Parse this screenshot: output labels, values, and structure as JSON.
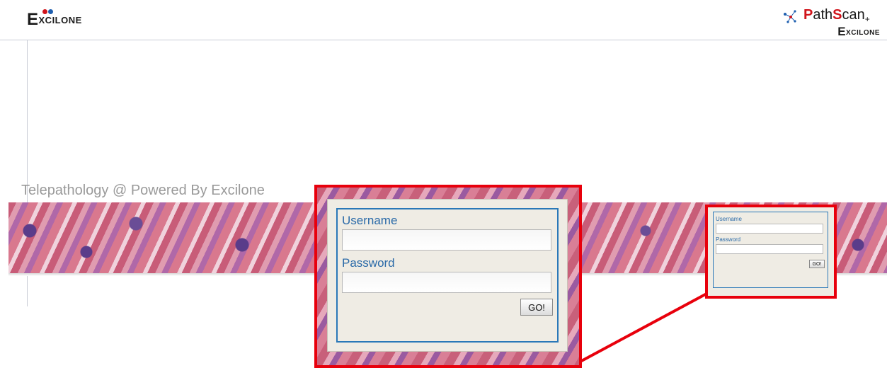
{
  "header": {
    "logo_left": {
      "initial": "E",
      "rest": "XCILONE"
    },
    "logo_right": {
      "title_p": "P",
      "title_ath": "ath",
      "title_s": "S",
      "title_can": "can",
      "title_plus": "+",
      "sub_initial": "E",
      "sub_rest": "XCILONE"
    }
  },
  "tagline": "Telepathology @ Powered By Excilone",
  "login": {
    "username_label": "Username",
    "username_value": "",
    "password_label": "Password",
    "password_value": "",
    "go_label": "GO!"
  },
  "colors": {
    "accent_red": "#e8000c",
    "label_blue": "#2a6aa8",
    "brand_red": "#d1141b"
  }
}
